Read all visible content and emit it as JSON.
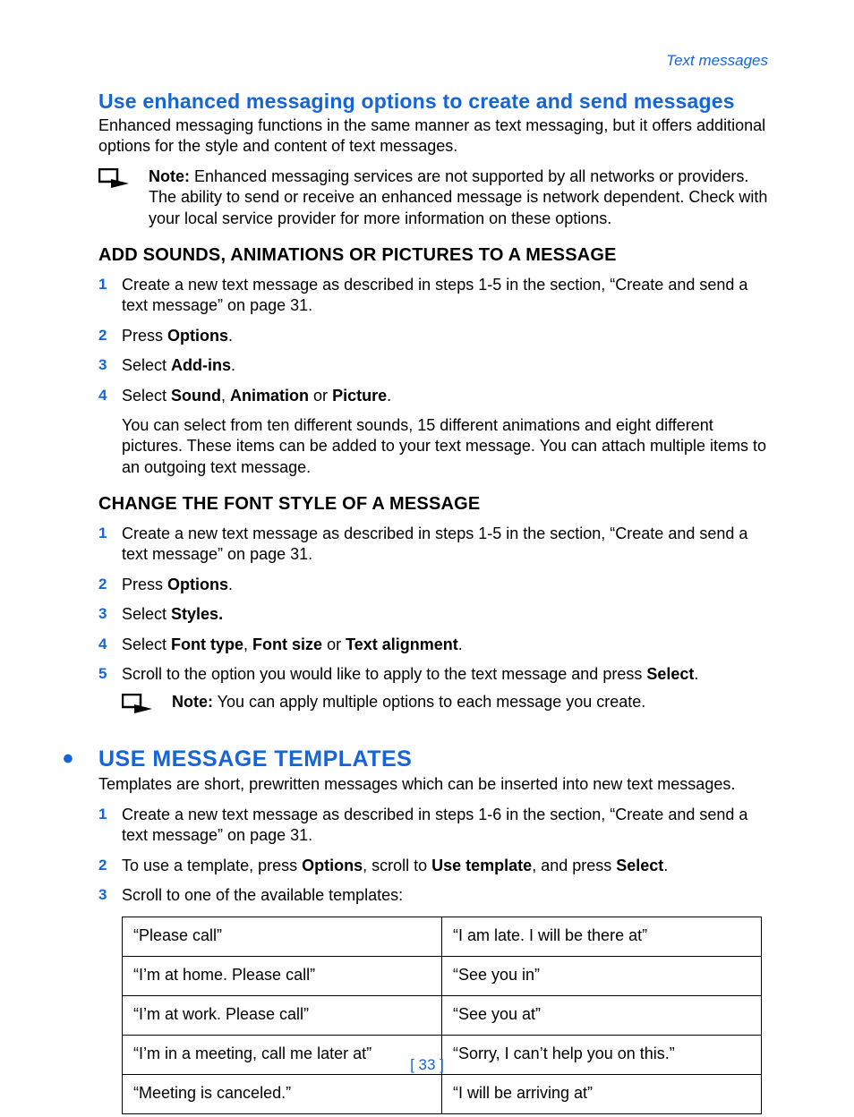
{
  "header": {
    "breadcrumb": "Text messages"
  },
  "title1": "Use enhanced messaging options to create and send messages",
  "intro1": "Enhanced messaging functions in the same manner as text messaging, but it offers additional options for the style and content of text messages.",
  "note1": {
    "label": "Note:",
    "text": " Enhanced messaging services are not supported by all networks or providers. The ability to send or receive an enhanced message is network dependent. Check with your local service provider for more information on these options."
  },
  "sub1": "ADD SOUNDS, ANIMATIONS OR PICTURES TO A MESSAGE",
  "steps1": [
    {
      "n": "1",
      "pre": "Create a new text message as described in steps 1-5 in the section, “Create and send a text message” on page 31."
    },
    {
      "n": "2",
      "pre": "Press ",
      "b1": "Options",
      "post": "."
    },
    {
      "n": "3",
      "pre": "Select ",
      "b1": "Add-ins",
      "post": "."
    },
    {
      "n": "4",
      "pre": "Select ",
      "b1": "Sound",
      "mid1": ", ",
      "b2": "Animation",
      "mid2": " or ",
      "b3": "Picture",
      "post": "."
    }
  ],
  "extra1": "You can select from ten different sounds, 15 different animations and eight different pictures. These items can be added to your text message. You can attach multiple items to an outgoing text message.",
  "sub2": "CHANGE THE FONT STYLE OF A MESSAGE",
  "steps2": [
    {
      "n": "1",
      "pre": "Create a new text message as described in steps 1-5 in the section, “Create and send a text message” on page 31."
    },
    {
      "n": "2",
      "pre": "Press ",
      "b1": "Options",
      "post": "."
    },
    {
      "n": "3",
      "pre": "Select ",
      "b1": "Styles.",
      "post": ""
    },
    {
      "n": "4",
      "pre": "Select ",
      "b1": "Font type",
      "mid1": ", ",
      "b2": "Font size",
      "mid2": " or ",
      "b3": "Text alignment",
      "post": "."
    },
    {
      "n": "5",
      "pre": "Scroll to the option you would like to apply to the text message and press ",
      "b1": "Select",
      "post": "."
    }
  ],
  "note2": {
    "label": "Note:",
    "text": " You can apply multiple options to each message you create."
  },
  "title2": "USE MESSAGE TEMPLATES",
  "intro2": "Templates are short, prewritten messages which can be inserted into new text messages.",
  "steps3": [
    {
      "n": "1",
      "pre": "Create a new text message as described in steps 1-6 in the section, “Create and send a text message” on page 31."
    },
    {
      "n": "2",
      "pre": "To use a template, press ",
      "b1": "Options",
      "mid1": ", scroll to ",
      "b2": "Use template",
      "mid2": ", and press ",
      "b3": "Select",
      "post": "."
    },
    {
      "n": "3",
      "pre": "Scroll to one of the available templates:"
    }
  ],
  "table": [
    [
      "“Please call”",
      "“I am late. I will be there at”"
    ],
    [
      "“I’m at home. Please call”",
      "“See you in”"
    ],
    [
      "“I’m at work. Please call”",
      "“See you at”"
    ],
    [
      "“I’m in a meeting, call me later at”",
      "“Sorry, I can’t help you on this.”"
    ],
    [
      "“Meeting is canceled.”",
      "“I will be arriving at”"
    ]
  ],
  "footer": "[ 33 ]"
}
